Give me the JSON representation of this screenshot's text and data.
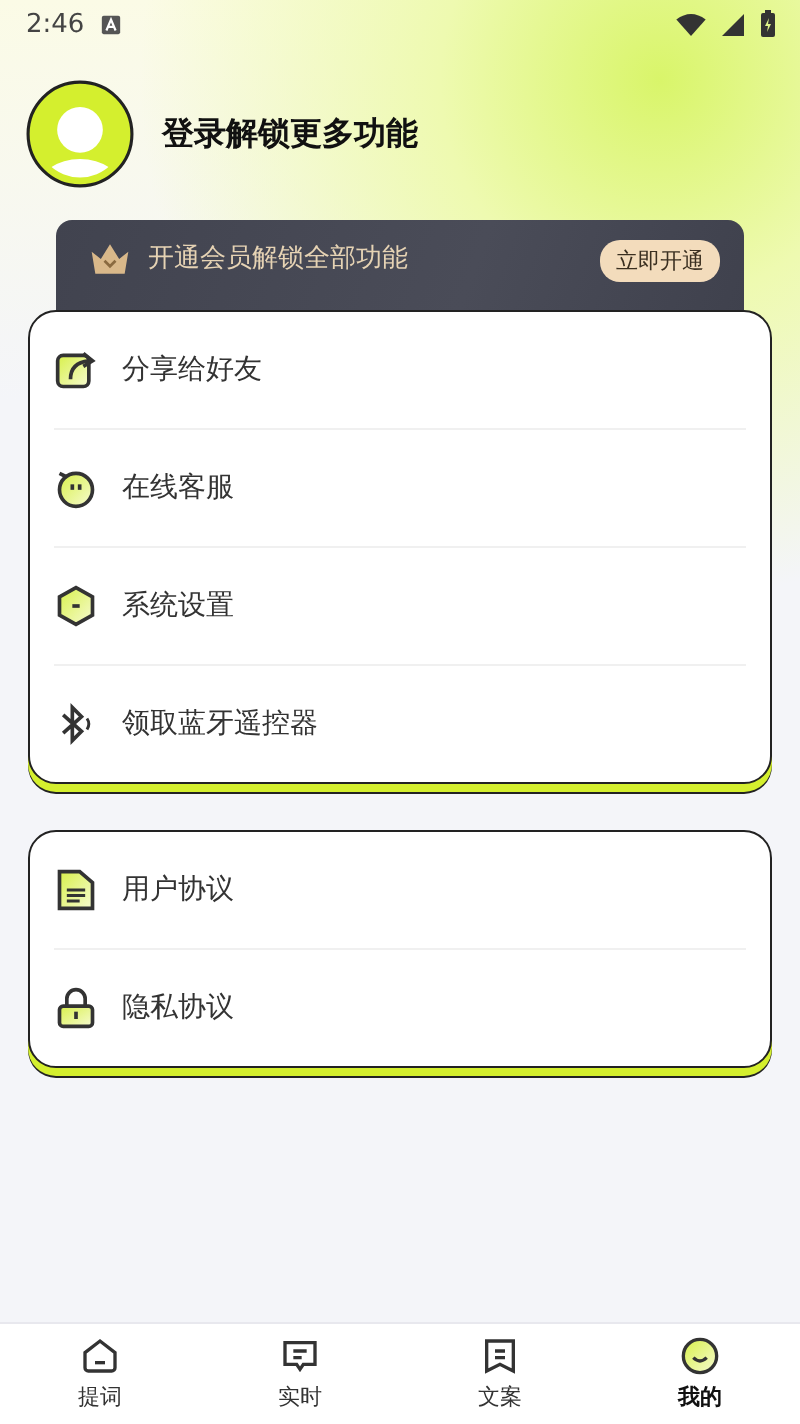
{
  "status_bar": {
    "time": "2:46"
  },
  "profile": {
    "title": "登录解锁更多功能"
  },
  "vip_banner": {
    "text": "开通会员解锁全部功能",
    "button": "立即开通"
  },
  "menu_groups": [
    {
      "items": [
        {
          "label": "分享给好友"
        },
        {
          "label": "在线客服"
        },
        {
          "label": "系统设置"
        },
        {
          "label": "领取蓝牙遥控器"
        }
      ]
    },
    {
      "items": [
        {
          "label": "用户协议"
        },
        {
          "label": "隐私协议"
        }
      ]
    }
  ],
  "bottom_nav": [
    {
      "label": "提词",
      "selected": false
    },
    {
      "label": "实时",
      "selected": false
    },
    {
      "label": "文案",
      "selected": false
    },
    {
      "label": "我的",
      "selected": true
    }
  ]
}
